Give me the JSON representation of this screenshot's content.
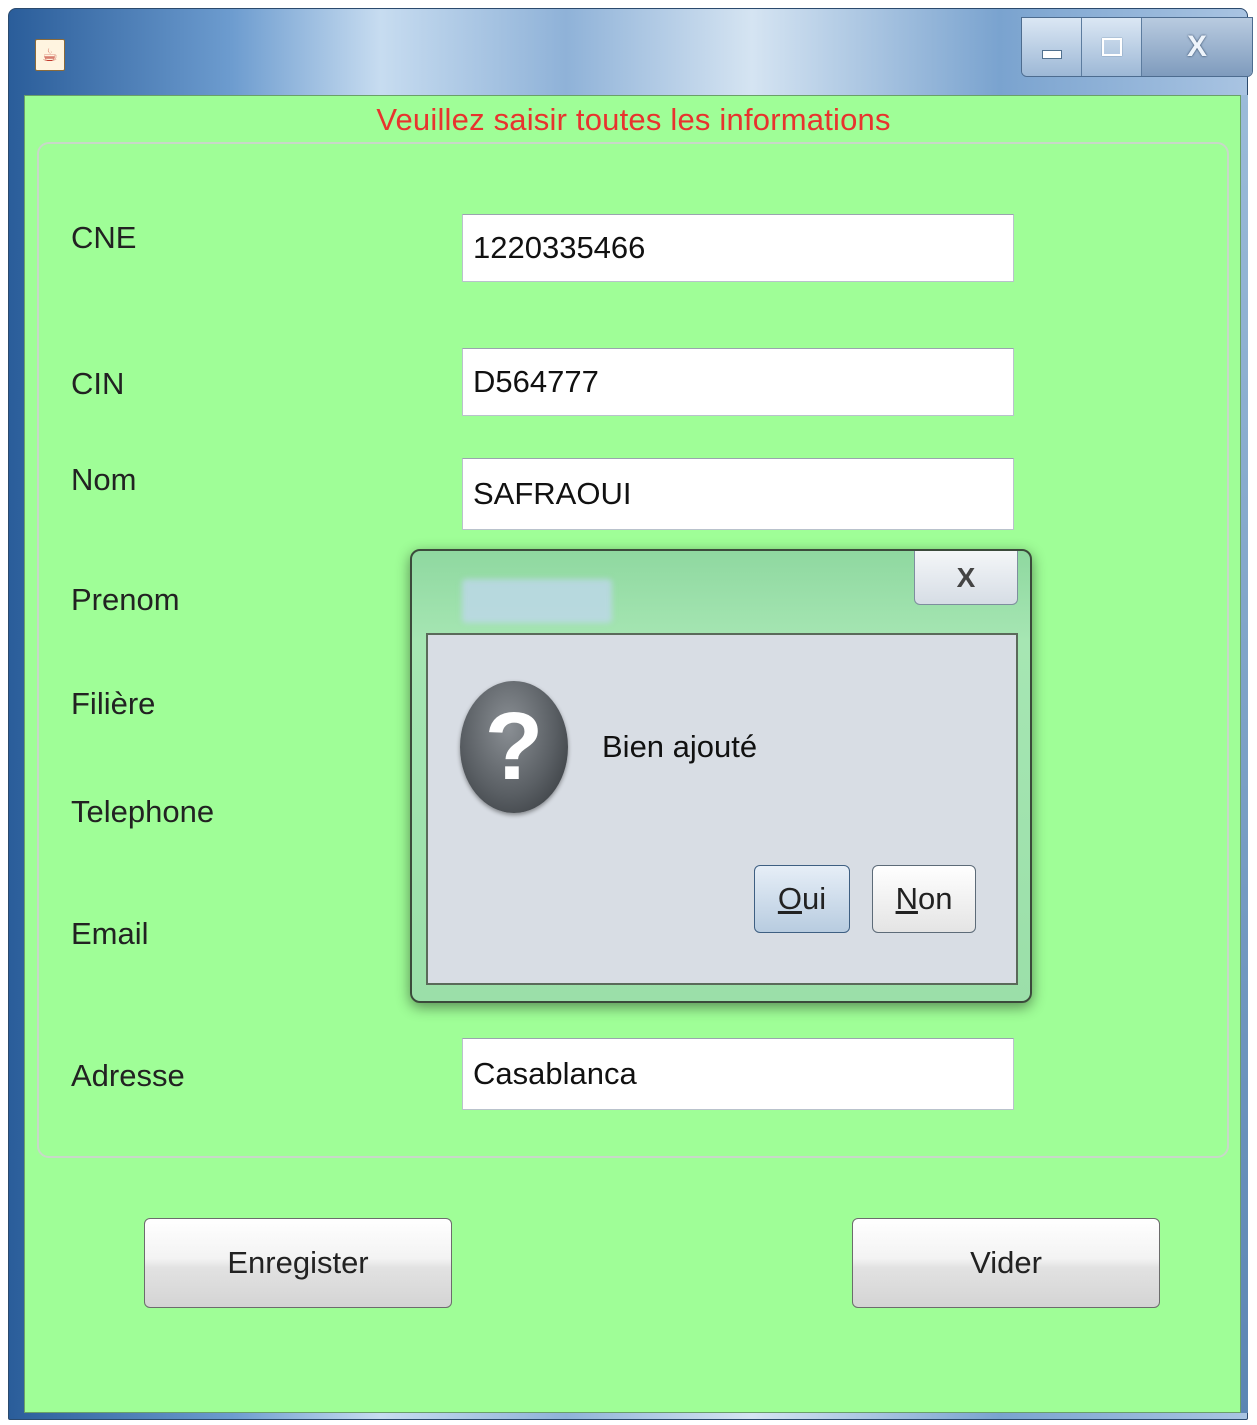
{
  "window": {
    "app_icon": "java-coffee-icon",
    "controls": {
      "minimize_icon": "minimize-icon",
      "maximize_icon": "maximize-icon",
      "close_label": "X"
    }
  },
  "form": {
    "heading": "Veuillez saisir toutes les informations",
    "heading_color": "#e8332e",
    "background_color": "#9ffe97",
    "fields": [
      {
        "label": "CNE",
        "value": "1220335466"
      },
      {
        "label": "CIN",
        "value": "D564777"
      },
      {
        "label": "Nom",
        "value": "SAFRAOUI"
      },
      {
        "label": "Prenom",
        "value": ""
      },
      {
        "label": "Filière",
        "value": ""
      },
      {
        "label": "Telephone",
        "value": ""
      },
      {
        "label": "Email",
        "value": ""
      },
      {
        "label": "Adresse",
        "value": "Casablanca"
      }
    ],
    "buttons": {
      "save": "Enregister",
      "clear": "Vider"
    }
  },
  "dialog": {
    "close_label": "X",
    "icon": "question-icon",
    "message": "Bien ajouté",
    "yes": {
      "mnemonic": "O",
      "rest": "ui"
    },
    "no": {
      "mnemonic": "N",
      "rest": "on"
    }
  }
}
